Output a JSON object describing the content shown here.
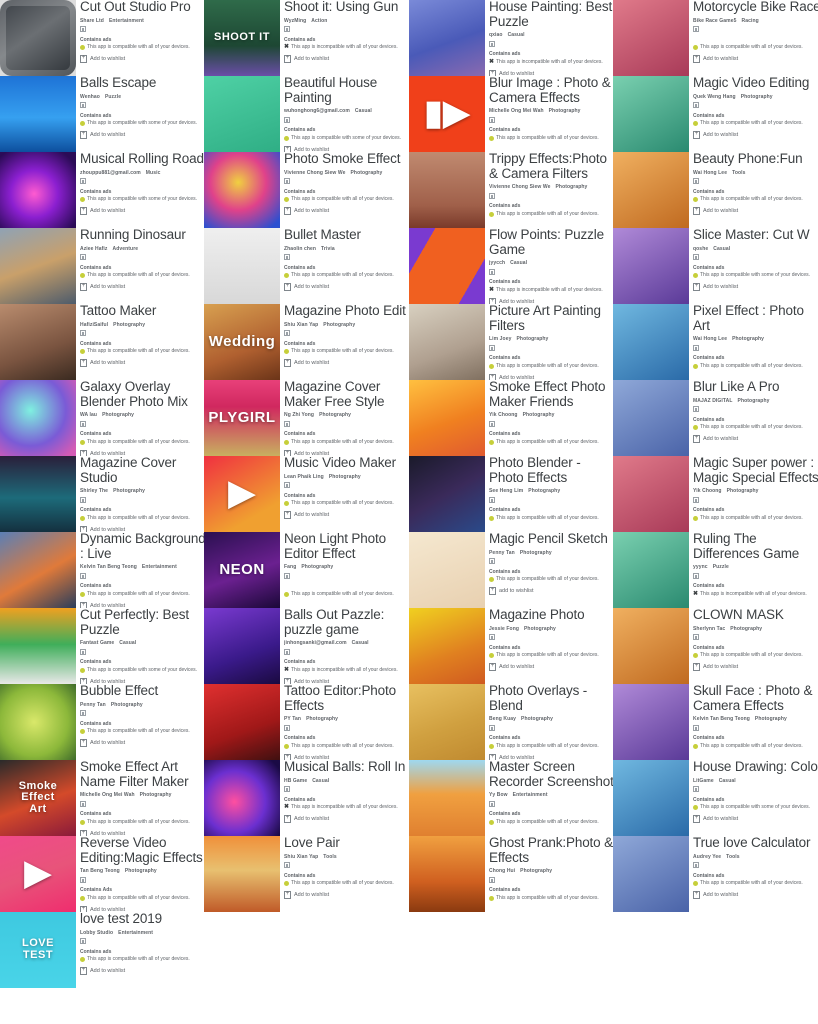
{
  "meta": {
    "screen": "app-list-collage",
    "contains_ads_label": "Contains ads",
    "contains_ads_label_alt": "Contains Ads",
    "compatible_all": "This app is compatible with all of your devices.",
    "compatible_some": "This app is compatible with some of your devices.",
    "incompatible_all": "This app is incompatible with all of your devices.",
    "wishlist_label": "Add to wishlist",
    "wishlist_label_alt": "add to wishlist",
    "separator": "·"
  },
  "colors": {
    "title": "#3c4043",
    "subtext": "#5f6368",
    "compat_dot": "#c6cf3a",
    "background": "#ffffff"
  },
  "columns": [
    {
      "id": "column-1",
      "apps": [
        {
          "title": "Cut Out Studio Pro",
          "dev": "Share Ltd",
          "category": "Entertainment",
          "ads": "Contains ads",
          "compat": "all",
          "wishlist": "Add to wishlist",
          "art": "photo-frame-dark",
          "glyph": ""
        },
        {
          "title": "Balls Escape",
          "dev": "Wenhao",
          "category": "Puzzle",
          "ads": "Contains ads",
          "compat": "some",
          "wishlist": "Add to wishlist",
          "art": "watermelon-slice",
          "glyph": ""
        },
        {
          "title": "Musical Rolling Road",
          "dev": "zhouppu881@gmail.com",
          "category": "Music",
          "ads": "Contains ads",
          "compat": "some",
          "wishlist": "Add to wishlist",
          "art": "neon-ball-road",
          "glyph": ""
        },
        {
          "title": "Running Dinosaur",
          "dev": "Aziee Hafiz",
          "category": "Adventure",
          "ads": "Contains ads",
          "compat": "all",
          "wishlist": "Add to wishlist",
          "art": "dinosaur-city",
          "glyph": ""
        },
        {
          "title": "Tattoo Maker",
          "dev": "HafiziSaiful",
          "category": "Photography",
          "ads": "Contains ads",
          "compat": "all",
          "wishlist": "Add to wishlist",
          "art": "tattoo-chest",
          "glyph": ""
        },
        {
          "title": "Galaxy Overlay Blender Photo Mix",
          "dev": "WA lau",
          "category": "Photography",
          "ads": "Contains ads",
          "compat": "all",
          "wishlist": "Add to wishlist",
          "art": "galaxy-overlay",
          "glyph": ""
        },
        {
          "title": "Magazine Cover Studio",
          "dev": "Shirley The",
          "category": "Photography",
          "ads": "Contains ads",
          "compat": "all",
          "wishlist": "Add to wishlist",
          "art": "magazine-woman",
          "glyph": ""
        },
        {
          "title": "Dynamic Background : Live",
          "dev": "Kelvin Tan Beng Teong",
          "category": "Entertainment",
          "ads": "Contains ads",
          "compat": "all",
          "wishlist": "Add to wishlist",
          "art": "phone-wallpaper",
          "glyph": ""
        },
        {
          "title": "Cut Perfectly: Best Puzzle",
          "dev": "Fantast Game",
          "category": "Casual",
          "ads": "Contains ads",
          "compat": "some",
          "wishlist": "Add to wishlist",
          "art": "knife-cut-food",
          "glyph": ""
        },
        {
          "title": "Bubble Effect",
          "dev": "Penny Tan",
          "category": "Photography",
          "ads": "Contains ads",
          "compat": "all",
          "wishlist": "Add to wishlist",
          "art": "bubble-heart",
          "glyph": ""
        },
        {
          "title": "Smoke Effect Art Name Filter Maker",
          "dev": "Michelle Ong Mei Wah",
          "category": "Photography",
          "ads": "Contains ads",
          "compat": "all",
          "wishlist": "Add to wishlist",
          "art": "smoke-art",
          "glyph": "Smoke\nEffect\nArt"
        },
        {
          "title": "Reverse Video Editing:Magic Effects",
          "dev": "Tan Beng Teong",
          "category": "Photography",
          "ads": "Contains Ads",
          "compat": "all",
          "wishlist": "Add to wishlist",
          "art": "video-play-pink",
          "glyph": "▶"
        },
        {
          "title": "love test 2019",
          "dev": "Lobby Studio",
          "category": "Entertainment",
          "ads": "Contains ads",
          "compat": "all",
          "wishlist": "Add to wishlist",
          "art": "love-test-hearts",
          "glyph": "LOVE\nTEST"
        }
      ]
    },
    {
      "id": "column-2",
      "apps": [
        {
          "title": "Shoot it: Using Gun",
          "dev": "WyzMing",
          "category": "Action",
          "ads": "Contains ads",
          "compat": "incompatible",
          "wishlist": "Add to wishlist",
          "art": "shoot-it-pixel",
          "glyph": "SHOOT IT"
        },
        {
          "title": "Beautiful House Painting",
          "dev": "wuhonghong6@gmail.com",
          "category": "Casual",
          "ads": "Contains ads",
          "compat": "some",
          "wishlist": "Add to wishlist",
          "art": "house-paint-iso",
          "glyph": ""
        },
        {
          "title": "Photo Smoke Effect",
          "dev": "Vivienne Chong Siew We",
          "category": "Photography",
          "ads": "Contains ads",
          "compat": "all",
          "wishlist": "Add to wishlist",
          "art": "smoke-portrait",
          "glyph": ""
        },
        {
          "title": "Bullet Master",
          "dev": "Zhaolin chen",
          "category": "Trivia",
          "ads": "Contains ads",
          "compat": "all",
          "wishlist": "Add to wishlist",
          "art": "bullet-master-scene",
          "glyph": ""
        },
        {
          "title": "Magazine Photo Edit",
          "dev": "Shiu Xian Yap",
          "category": "Photography",
          "ads": "Contains ads",
          "compat": "all",
          "wishlist": "Add to wishlist",
          "art": "wedding-magazine",
          "glyph": "Wedding"
        },
        {
          "title": "Magazine Cover Maker Free Style",
          "dev": "Ng Zhi Yong",
          "category": "Photography",
          "ads": "Contains ads",
          "compat": "all",
          "wishlist": "Add to wishlist",
          "art": "plygirl-cover",
          "glyph": "PLYGIRL"
        },
        {
          "title": "Music Video Maker",
          "dev": "Lean Phaik Ling",
          "category": "Photography",
          "ads": "Contains ads",
          "compat": "all",
          "wishlist": "Add to wishlist",
          "art": "film-play-red",
          "glyph": "▶"
        },
        {
          "title": "Neon Light Photo Editor Effect",
          "dev": "Fang",
          "category": "Photography",
          "ads": "",
          "compat": "all",
          "wishlist": "",
          "art": "neon-queen",
          "glyph": "NEON"
        },
        {
          "title": "Balls Out Pazzle: puzzle game",
          "dev": "jinhongsanki@gmail.com",
          "category": "Casual",
          "ads": "Contains ads",
          "compat": "incompatible",
          "wishlist": "Add to wishlist",
          "art": "neon-balls-purple",
          "glyph": ""
        },
        {
          "title": "Tattoo Editor:Photo Effects",
          "dev": "PY Tan",
          "category": "Photography",
          "ads": "Contains ads",
          "compat": "all",
          "wishlist": "Add to wishlist",
          "art": "tattoo-woman-red",
          "glyph": ""
        },
        {
          "title": "Musical Balls: Roll In",
          "dev": "HB Game",
          "category": "Casual",
          "ads": "Contains ads",
          "compat": "incompatible",
          "wishlist": "Add to wishlist",
          "art": "musical-balls-roll",
          "glyph": ""
        },
        {
          "title": "Love Pair",
          "dev": "Shiu Xian Yap",
          "category": "Tools",
          "ads": "Contains ads",
          "compat": "all",
          "wishlist": "Add to wishlist",
          "art": "hands-heart-sunset",
          "glyph": ""
        }
      ]
    },
    {
      "id": "column-3",
      "apps": [
        {
          "title": "House Painting: Best Puzzle",
          "dev": "qxiao",
          "category": "Casual",
          "ads": "Contains ads",
          "compat": "incompatible",
          "wishlist": "Add to wishlist",
          "art": "motorbike-race",
          "glyph": ""
        },
        {
          "title": "Blur Image : Photo & Camera Effects",
          "dev": "Michelle Ong Mei Wah",
          "category": "Photography",
          "ads": "Contains ads",
          "compat": "all",
          "wishlist": "",
          "art": "video-cam-orange",
          "glyph": "▮▶"
        },
        {
          "title": "Trippy Effects:Photo & Camera Filters",
          "dev": "Vivienne Chong Siew We",
          "category": "Photography",
          "ads": "Contains ads",
          "compat": "all",
          "wishlist": "",
          "art": "call-screen-lips",
          "glyph": ""
        },
        {
          "title": "Flow Points: Puzzle Game",
          "dev": "jyycch",
          "category": "Casual",
          "ads": "Contains ads",
          "compat": "incompatible",
          "wishlist": "Add to wishlist",
          "art": "slice-master-orange",
          "glyph": ""
        },
        {
          "title": "Picture Art Painting Filters",
          "dev": "Lim Joey",
          "category": "Photography",
          "ads": "Contains ads",
          "compat": "all",
          "wishlist": "Add to wishlist",
          "art": "pixel-effect-girl",
          "glyph": ""
        },
        {
          "title": "Smoke Effect Photo Maker Friends",
          "dev": "Yik Choong",
          "category": "Photography",
          "ads": "Contains ads",
          "compat": "all",
          "wishlist": "",
          "art": "blur-pro-girl",
          "glyph": ""
        },
        {
          "title": "Photo Blender - Photo Effects",
          "dev": "See Heng Lim",
          "category": "Photography",
          "ads": "Contains ads",
          "compat": "all",
          "wishlist": "",
          "art": "superhero-dark",
          "glyph": ""
        },
        {
          "title": "Magic Pencil Sketch",
          "dev": "Penny Tan",
          "category": "Photography",
          "ads": "Contains ads",
          "compat": "all",
          "wishlist": "add to wishlist",
          "art": "kitchen-cartoon",
          "glyph": ""
        },
        {
          "title": "Magazine Photo",
          "dev": "Jessie Fong",
          "category": "Photography",
          "ads": "Contains ads",
          "compat": "all",
          "wishlist": "Add to wishlist",
          "art": "clown-mask-face",
          "glyph": ""
        },
        {
          "title": "Photo Overlays - Blend",
          "dev": "Beng Kuay",
          "category": "Photography",
          "ads": "Contains ads",
          "compat": "all",
          "wishlist": "Add to wishlist",
          "art": "skull-face-paint",
          "glyph": ""
        },
        {
          "title": "Master Screen Recorder Screenshot",
          "dev": "Yy Bow",
          "category": "Entertainment",
          "ads": "Contains ads",
          "compat": "all",
          "wishlist": "",
          "art": "house-draw-iso",
          "glyph": ""
        },
        {
          "title": "Ghost Prank:Photo & Effects",
          "dev": "Chong Hui",
          "category": "Photography",
          "ads": "Contains ads",
          "compat": "all",
          "wishlist": "",
          "art": "couple-silhouette",
          "glyph": ""
        }
      ]
    },
    {
      "id": "column-4",
      "apps": [
        {
          "title": "Motorcycle Bike Race",
          "dev": "Bike Race Game5",
          "category": "Racing",
          "ads": "",
          "compat": "all",
          "wishlist": "Add to wishlist",
          "art": "",
          "glyph": ""
        },
        {
          "title": "Magic Video Editing",
          "dev": "Quek Weng Hang",
          "category": "Photography",
          "ads": "Contains ads",
          "compat": "all",
          "wishlist": "Add to wishlist",
          "art": "",
          "glyph": ""
        },
        {
          "title": "Beauty Phone:Fun",
          "dev": "Wai Hong Lee",
          "category": "Tools",
          "ads": "Contains ads",
          "compat": "all",
          "wishlist": "Add to wishlist",
          "art": "",
          "glyph": ""
        },
        {
          "title": "Slice Master: Cut W",
          "dev": "qoshe",
          "category": "Casual",
          "ads": "Contains ads",
          "compat": "some",
          "wishlist": "Add to wishlist",
          "art": "",
          "glyph": ""
        },
        {
          "title": "Pixel Effect : Photo Art",
          "dev": "Wai Hong Lee",
          "category": "Photography",
          "ads": "Contains ads",
          "compat": "all",
          "wishlist": "",
          "art": "",
          "glyph": ""
        },
        {
          "title": "Blur Like A Pro",
          "dev": "MAJAZ DIGITAL",
          "category": "Photography",
          "ads": "Contains ads",
          "compat": "all",
          "wishlist": "Add to wishlist",
          "art": "",
          "glyph": ""
        },
        {
          "title": "Magic Super power : Magic Special Effects",
          "dev": "Yik Choong",
          "category": "Photography",
          "ads": "Contains ads",
          "compat": "all",
          "wishlist": "",
          "art": "",
          "glyph": ""
        },
        {
          "title": "Ruling The Differences Game",
          "dev": "yyync",
          "category": "Puzzle",
          "ads": "Contains ads",
          "compat": "incompatible",
          "wishlist": "",
          "art": "",
          "glyph": ""
        },
        {
          "title": "CLOWN MASK",
          "dev": "Sherlynn Tac",
          "category": "Photography",
          "ads": "Contains ads",
          "compat": "all",
          "wishlist": "Add to wishlist",
          "art": "",
          "glyph": ""
        },
        {
          "title": "Skull Face : Photo & Camera Effects",
          "dev": "Kelvin Tan Beng Teong",
          "category": "Photography",
          "ads": "Contains ads",
          "compat": "all",
          "wishlist": "",
          "art": "",
          "glyph": ""
        },
        {
          "title": "House Drawing: Color",
          "dev": "LitGame",
          "category": "Casual",
          "ads": "Contains ads",
          "compat": "some",
          "wishlist": "Add to wishlist",
          "art": "",
          "glyph": ""
        },
        {
          "title": "True love Calculator",
          "dev": "Audrey Yee",
          "category": "Tools",
          "ads": "Contains ads",
          "compat": "all",
          "wishlist": "Add to wishlist",
          "art": "",
          "glyph": ""
        }
      ]
    }
  ]
}
